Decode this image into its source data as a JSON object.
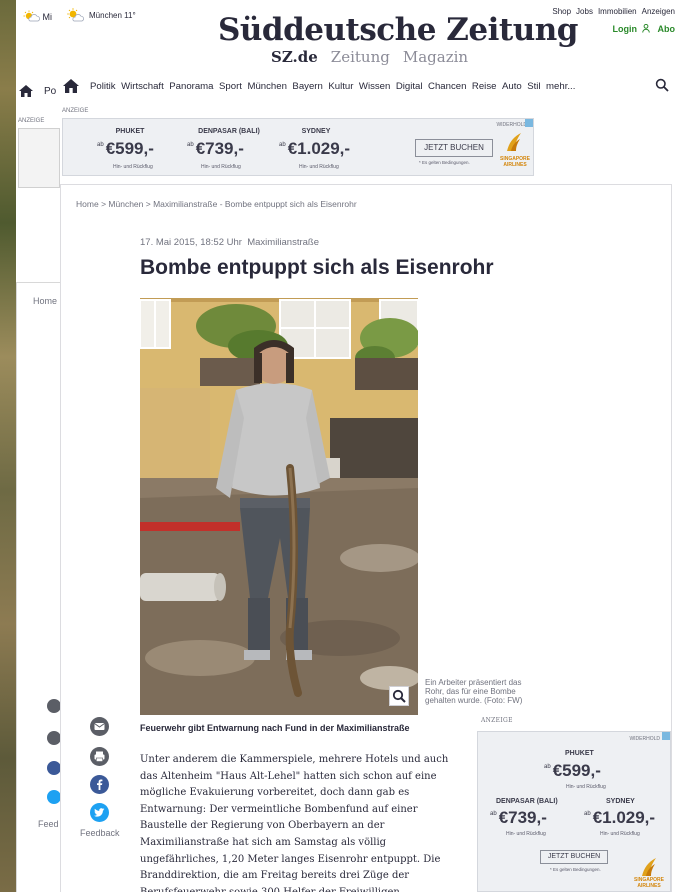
{
  "ghost": {
    "weather": "Mi",
    "nav_first": "Po",
    "anzeige": "ANZEIGE",
    "breadcrumb_home": "Home",
    "feedback": "Feed"
  },
  "header": {
    "weather": "München 11°",
    "logo": "Süddeutsche Zeitung",
    "brand_sz": "SZ.de",
    "brand_zeitung": "Zeitung",
    "brand_magazin": "Magazin",
    "top_links": [
      "Shop",
      "Jobs",
      "Immobilien",
      "Anzeigen"
    ],
    "login": "Login",
    "abo": "Abo"
  },
  "nav": {
    "items": [
      "Politik",
      "Wirtschaft",
      "Panorama",
      "Sport",
      "München",
      "Bayern",
      "Kultur",
      "Wissen",
      "Digital",
      "Chancen",
      "Reise",
      "Auto",
      "Stil",
      "mehr..."
    ]
  },
  "ad_banner": {
    "label": "ANZEIGE",
    "advertiser": "WIDERHOLD",
    "offers": [
      {
        "dest": "PHUKET",
        "price": "€599,-",
        "sub": "Hin- und Rückflug"
      },
      {
        "dest": "DENPASAR (BALI)",
        "price": "€739,-",
        "sub": "Hin- und Rückflug"
      },
      {
        "dest": "SYDNEY",
        "price": "€1.029,-",
        "sub": "Hin- und Rückflug"
      }
    ],
    "from": "ab",
    "cta": "JETZT BUCHEN",
    "conditions": "* Es gelten Bedingungen.",
    "airline": "SINGAPORE AIRLINES"
  },
  "article": {
    "breadcrumb": [
      "Home",
      "München",
      "Maximilianstraße - Bombe entpuppt sich als Eisenrohr"
    ],
    "breadcrumb_sep": ">",
    "date": "17. Mai 2015, 18:52 Uhr",
    "section": "Maximilianstraße",
    "headline": "Bombe entpuppt sich als Eisenrohr",
    "caption": "Ein Arbeiter präsentiert das Rohr, das für eine Bombe gehalten wurde.",
    "caption_credit": "(Foto: FW)",
    "subhead": "Feuerwehr gibt Entwarnung nach Fund in der Maximilianstraße",
    "body": "Unter anderem die Kammerspiele, mehrere Hotels und auch das Altenheim \"Haus Alt-Lehel\" hatten sich schon auf eine mögliche Evakuierung vorbereitet, doch dann gab es Entwarnung: Der vermeintliche Bombenfund auf einer Baustelle der Regierung von Oberbayern an der Maximilianstraße hat sich am Samstag als völlig ungefährliches, 1,20 Meter langes Eisenrohr entpuppt. Die Branddirektion, die am Freitag bereits drei Züge der Berufsfeuerwehr sowie 300 Helfer der Freiwilligen"
  },
  "share": {
    "feedback": "Feedback",
    "icons": [
      "mail-icon",
      "print-icon",
      "facebook-icon",
      "twitter-icon"
    ]
  },
  "ad_side": {
    "label": "ANZEIGE",
    "advertiser": "WIDERHOLD",
    "offers": [
      {
        "dest": "PHUKET",
        "price": "€599,-",
        "sub": "Hin- und Rückflug"
      },
      {
        "dest": "DENPASAR (BALI)",
        "price": "€739,-",
        "sub": "Hin- und Rückflug"
      },
      {
        "dest": "SYDNEY",
        "price": "€1.029,-",
        "sub": "Hin- und Rückflug"
      }
    ],
    "from": "ab",
    "cta": "JETZT BUCHEN",
    "conditions": "* Es gelten Bedingungen.",
    "airline": "SINGAPORE AIRLINES"
  },
  "colors": {
    "text": "#29293a",
    "muted": "#71737f",
    "login_green": "#2b8a2b",
    "facebook": "#3b5998",
    "twitter": "#1da1f2",
    "share_gray": "#5b5e66",
    "airline_gold": "#d4860b"
  }
}
